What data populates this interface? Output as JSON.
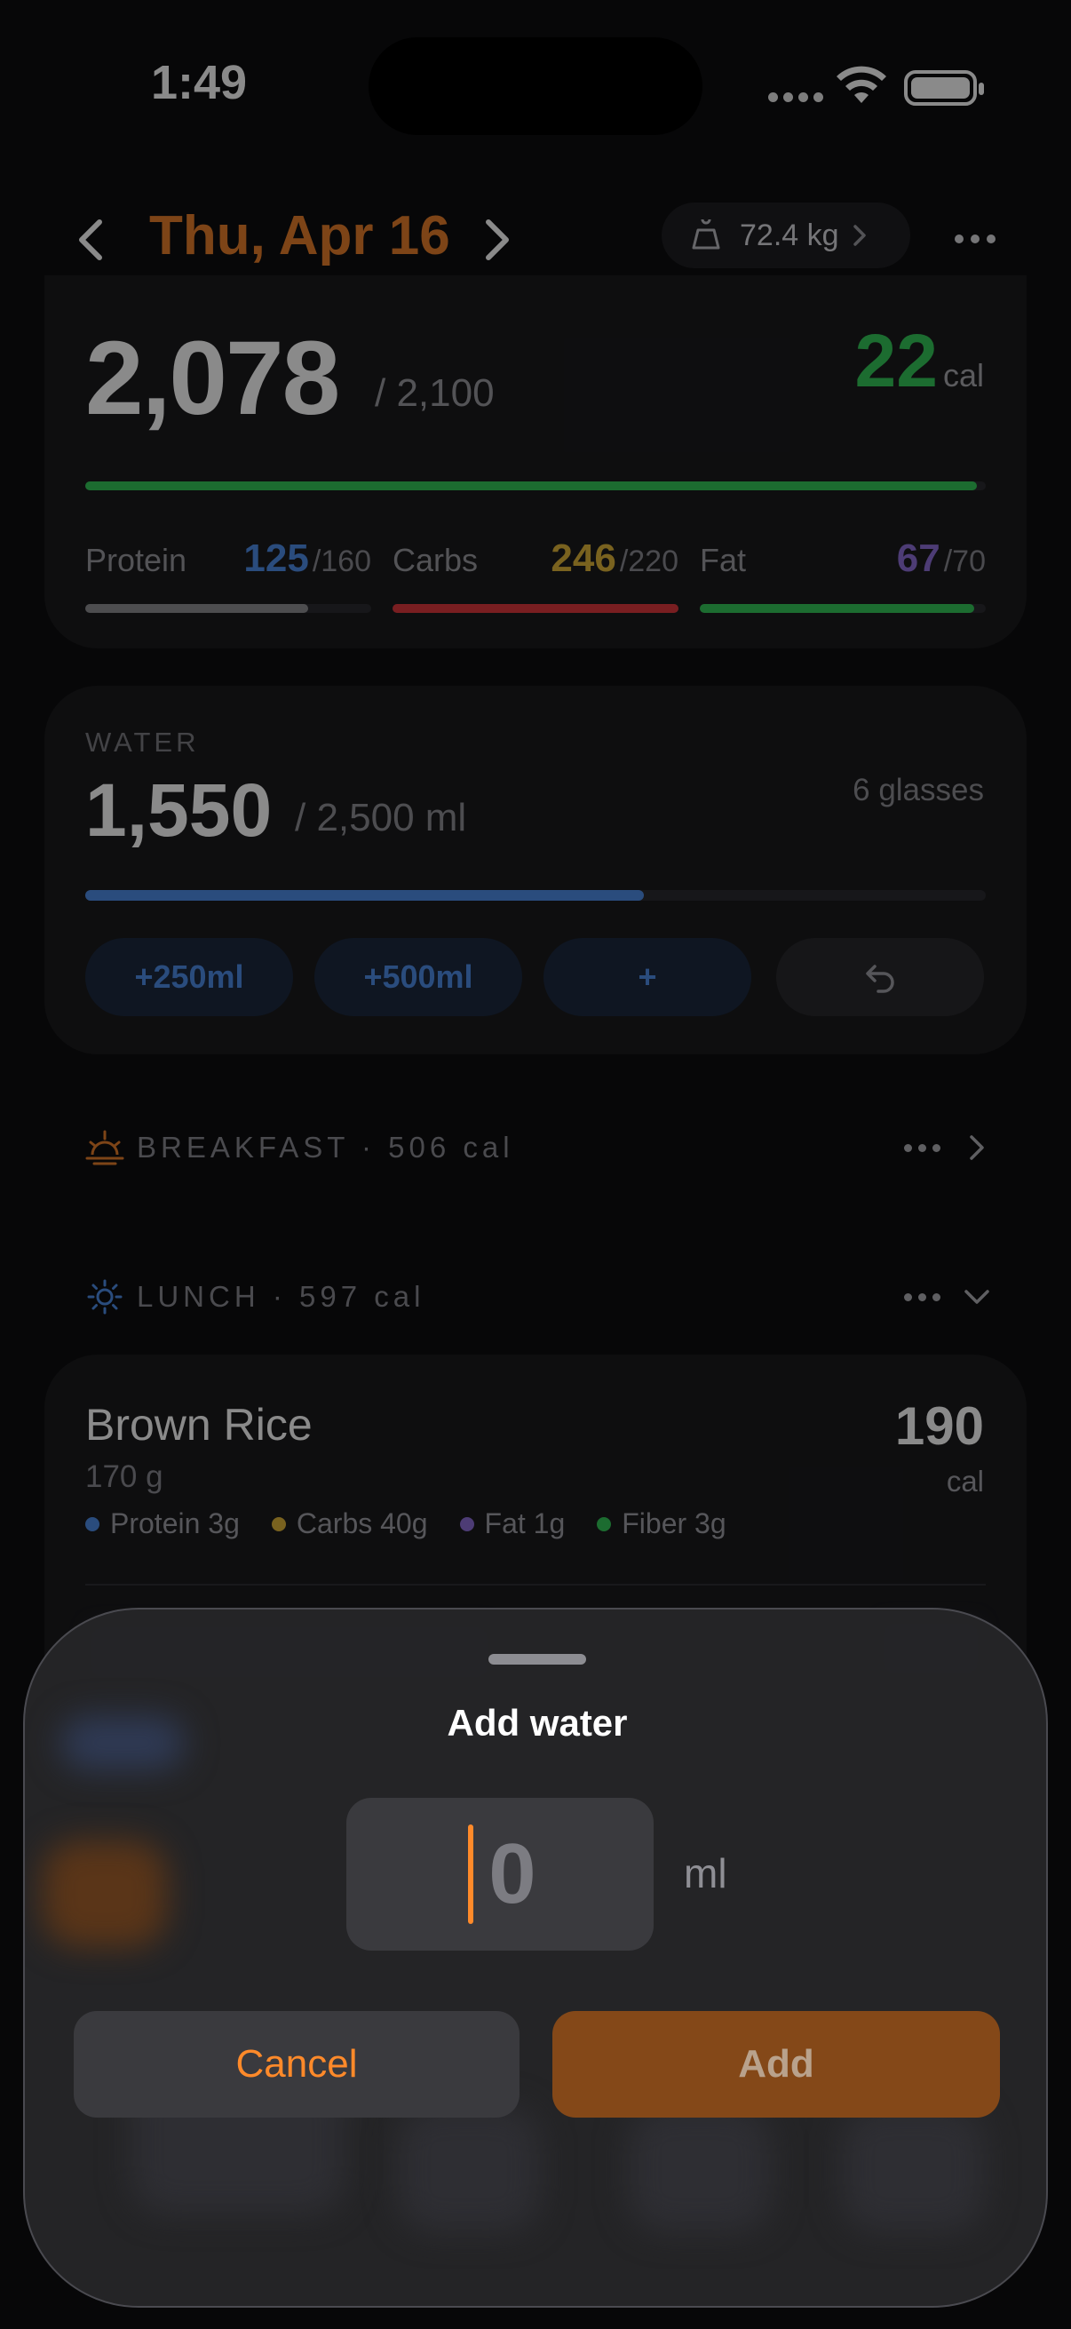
{
  "status_bar": {
    "time": "1:49"
  },
  "header": {
    "date": "Thu, Apr 16",
    "weight": "72.4 kg"
  },
  "calories": {
    "consumed": "2,078",
    "goal": "/ 2,100",
    "remaining": "22",
    "remaining_unit": "cal",
    "progress": 0.99,
    "color": "#34c759"
  },
  "macros": [
    {
      "label": "Protein",
      "value": "125",
      "goal": "/160",
      "progress": 0.78,
      "value_color": "#4f8de8",
      "bar_color": "#8e8e93"
    },
    {
      "label": "Carbs",
      "value": "246",
      "goal": "/220",
      "progress": 1.0,
      "value_color": "#e0b53a",
      "bar_color": "#e0383e"
    },
    {
      "label": "Fat",
      "value": "67",
      "goal": "/70",
      "progress": 0.96,
      "value_color": "#8e6fd8",
      "bar_color": "#34c759"
    }
  ],
  "water": {
    "label": "WATER",
    "amount": "1,550",
    "goal": "/ 2,500 ml",
    "glasses": "6 glasses",
    "progress": 0.62,
    "buttons": [
      "+250ml",
      "+500ml",
      "+"
    ],
    "color": "#4f8de8"
  },
  "meals": [
    {
      "label": "BREAKFAST · 506 cal",
      "icon": "sunrise-icon",
      "state": "collapsed"
    },
    {
      "label": "LUNCH · 597 cal",
      "icon": "sun-icon",
      "state": "expanded"
    }
  ],
  "food_item": {
    "name": "Brown Rice",
    "grams": "170 g",
    "calories": "190",
    "cal_unit": "cal",
    "nutrients": [
      {
        "label": "Protein 3g",
        "color": "#4f8de8"
      },
      {
        "label": "Carbs 40g",
        "color": "#e0b53a"
      },
      {
        "label": "Fat 1g",
        "color": "#8e6fd8"
      },
      {
        "label": "Fiber 3g",
        "color": "#34c759"
      }
    ]
  },
  "sheet": {
    "title": "Add water",
    "placeholder": "0",
    "unit": "ml",
    "cancel_label": "Cancel",
    "add_label": "Add",
    "accent": "#ff8a2a"
  }
}
